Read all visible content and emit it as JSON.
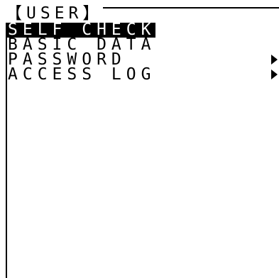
{
  "menu": {
    "title": "【USER】",
    "items": [
      {
        "label": "SELF CHECK",
        "selected": true,
        "has_submenu": false
      },
      {
        "label": "BASIC DATA",
        "selected": false,
        "has_submenu": false
      },
      {
        "label": "PASSWORD",
        "selected": false,
        "has_submenu": true
      },
      {
        "label": "ACCESS LOG",
        "selected": false,
        "has_submenu": true
      }
    ]
  },
  "colors": {
    "foreground": "#000000",
    "background": "#ffffff",
    "selection_background": "#000000",
    "selection_text": "#ffffff"
  },
  "icons": {
    "submenu": "triangle-right-icon"
  }
}
